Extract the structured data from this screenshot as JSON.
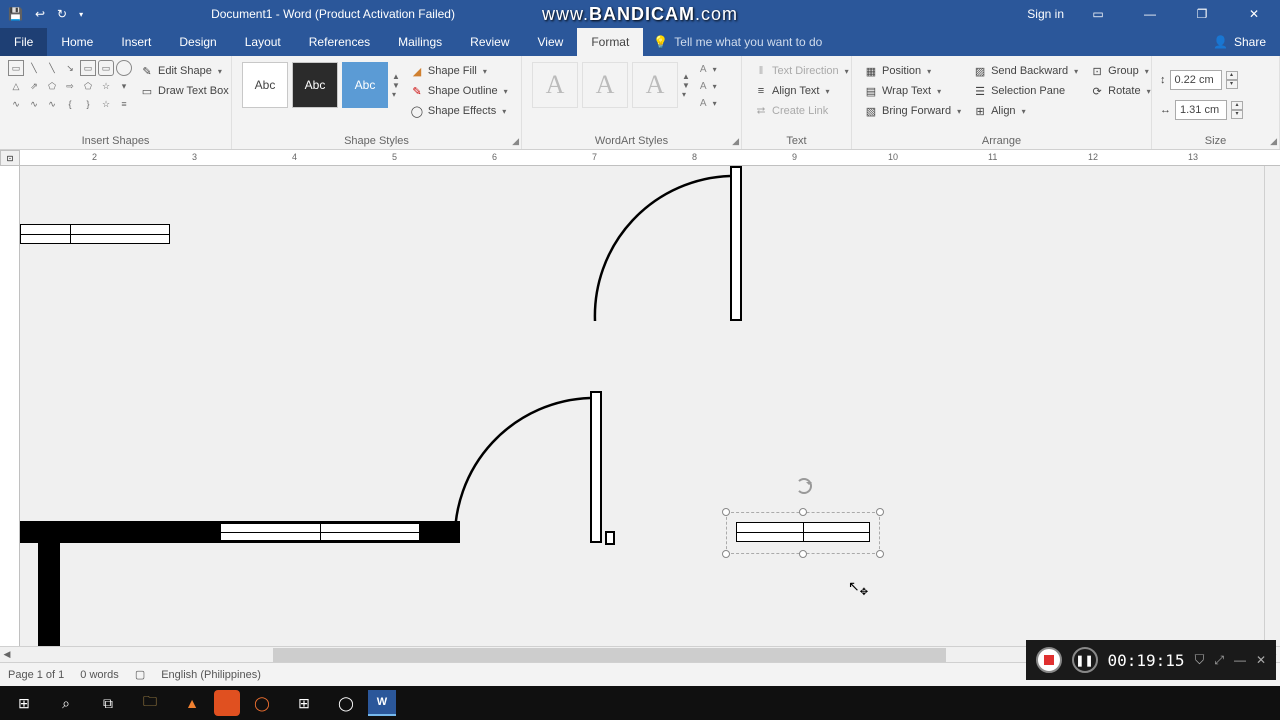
{
  "title": "Document1 - Word (Product Activation Failed)",
  "watermark_prefix": "www.",
  "watermark_main": "BANDICAM",
  "watermark_suffix": ".com",
  "sign_in": "Sign in",
  "tabs": {
    "file": "File",
    "home": "Home",
    "insert": "Insert",
    "design": "Design",
    "layout": "Layout",
    "references": "References",
    "mailings": "Mailings",
    "review": "Review",
    "view": "View",
    "format": "Format",
    "tellme": "Tell me what you want to do"
  },
  "share": "Share",
  "ribbon": {
    "insert_shapes": "Insert Shapes",
    "edit_shape": "Edit Shape",
    "draw_text_box": "Draw Text Box",
    "shape_styles": "Shape Styles",
    "style_label": "Abc",
    "shape_fill": "Shape Fill",
    "shape_outline": "Shape Outline",
    "shape_effects": "Shape Effects",
    "wordart_styles": "WordArt Styles",
    "wordart_a": "A",
    "text": "Text",
    "text_direction": "Text Direction",
    "align_text": "Align Text",
    "create_link": "Create Link",
    "arrange": "Arrange",
    "position": "Position",
    "wrap_text": "Wrap Text",
    "bring_forward": "Bring Forward",
    "send_backward": "Send Backward",
    "selection_pane": "Selection Pane",
    "group": "Group",
    "rotate": "Rotate",
    "align": "Align",
    "size": "Size",
    "height": "0.22 cm",
    "width": "1.31 cm"
  },
  "ruler_marks": [
    "2",
    "3",
    "4",
    "5",
    "6",
    "7",
    "8",
    "9",
    "10",
    "11",
    "12",
    "13"
  ],
  "status": {
    "page": "Page 1 of 1",
    "words": "0 words",
    "lang": "English (Philippines)"
  },
  "bandicam_time": "00:19:15"
}
